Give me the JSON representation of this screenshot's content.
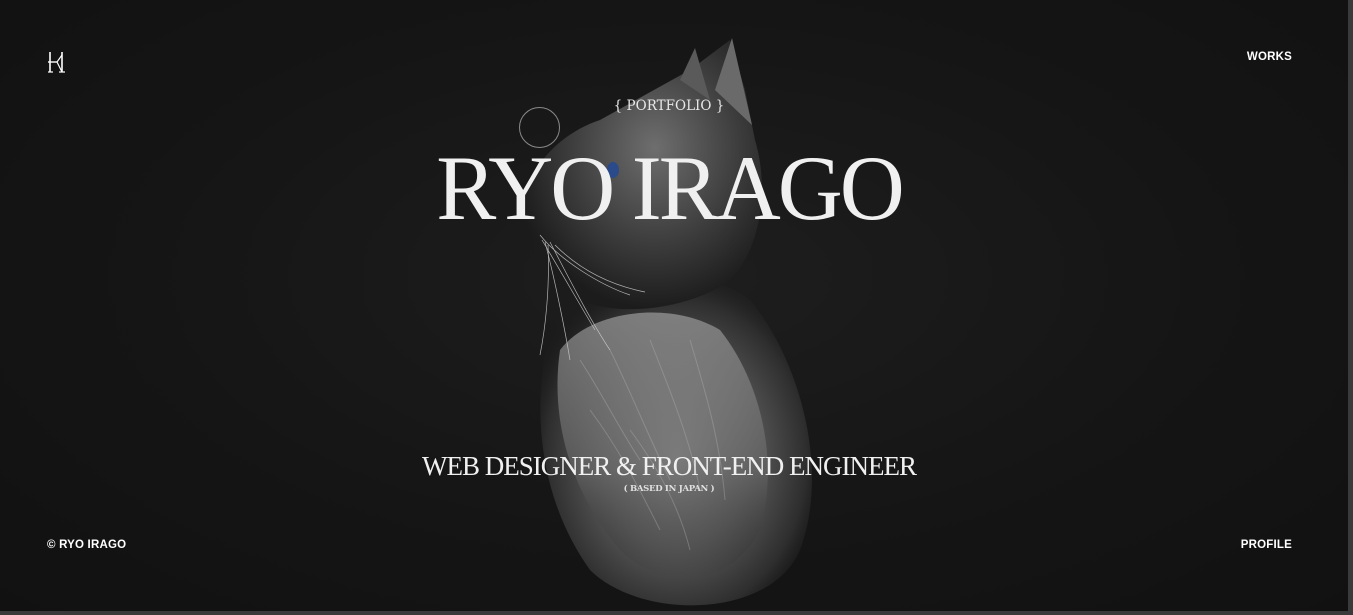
{
  "header": {
    "logo_alt": "RI monogram",
    "nav_works": "WORKS"
  },
  "hero": {
    "eyebrow": "{ PORTFOLIO }",
    "name": "RYO IRAGO",
    "role": "WEB DESIGNER & FRONT-END ENGINEER",
    "location": "( BASED IN JAPAN )",
    "image": "cat-portrait-monochrome"
  },
  "footer": {
    "copyright": "© RYO IRAGO",
    "nav_profile": "PROFILE"
  },
  "colors": {
    "background": "#151515",
    "text": "#f0f0f0",
    "cat_eye": "#2a4a8a"
  }
}
